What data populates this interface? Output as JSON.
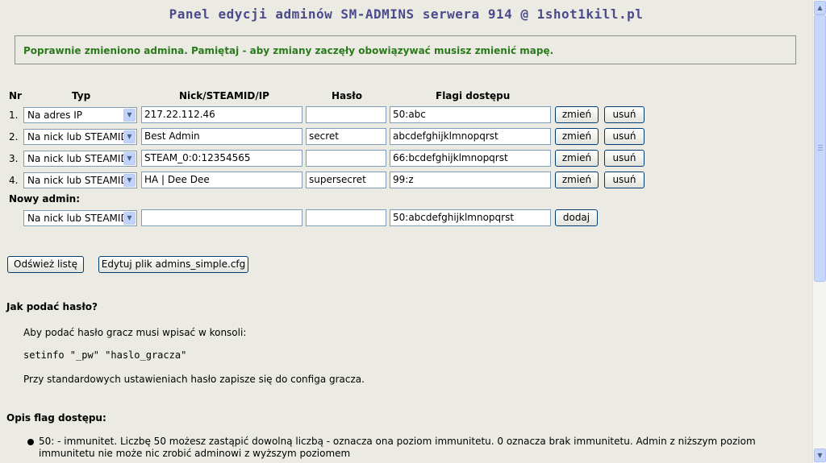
{
  "title": "Panel edycji adminów SM-ADMINS serwera 914 @ 1shot1kill.pl",
  "notice": "Poprawnie zmieniono admina. Pamiętaj - aby zmiany zaczęły obowiązywać musisz zmienić mapę.",
  "table": {
    "headers": {
      "nr": "Nr",
      "typ": "Typ",
      "nick": "Nick/STEAMID/IP",
      "haslo": "Hasło",
      "flagi": "Flagi dostępu"
    },
    "rows": [
      {
        "nr": "1.",
        "type": "Na adres IP",
        "nick": "217.22.112.46",
        "password": "",
        "flags": "50:abc"
      },
      {
        "nr": "2.",
        "type": "Na nick lub STEAMID",
        "nick": "Best Admin",
        "password": "secret",
        "flags": "abcdefghijklmnopqrst"
      },
      {
        "nr": "3.",
        "type": "Na nick lub STEAMID",
        "nick": "STEAM_0:0:12354565",
        "password": "",
        "flags": "66:bcdefghijklmnopqrst"
      },
      {
        "nr": "4.",
        "type": "Na nick lub STEAMID",
        "nick": "HA | Dee Dee",
        "password": "supersecret",
        "flags": "99:z"
      }
    ],
    "edit_label": "zmień",
    "delete_label": "usuń"
  },
  "new_admin": {
    "label": "Nowy admin:",
    "type": "Na nick lub STEAMID",
    "nick": "",
    "password": "",
    "flags": "50:abcdefghijklmnopqrst",
    "add_label": "dodaj"
  },
  "actions": {
    "refresh_label": "Odśwież listę",
    "edit_file_label": "Edytuj plik admins_simple.cfg"
  },
  "password_help": {
    "heading": "Jak podać hasło?",
    "intro": "Aby podać hasło gracz musi wpisać w konsoli:",
    "command": "setinfo \"_pw\" \"haslo_gracza\"",
    "note": "Przy standardowych ustawieniach hasło zapisze się do configa gracza."
  },
  "flags_help": {
    "heading": "Opis flag dostępu:",
    "items": [
      "50: - immunitet. Liczbę 50 możesz zastąpić dowolną liczbą - oznacza ona poziom immunitetu. 0 oznacza brak immunitetu. Admin z niższym poziom immunitetu nie może nic zrobić adminowi z wyższym poziomem"
    ]
  },
  "colors": {
    "background": "#ebebe4",
    "title": "#4b4b8c",
    "notice_text": "#2a7a1b"
  }
}
